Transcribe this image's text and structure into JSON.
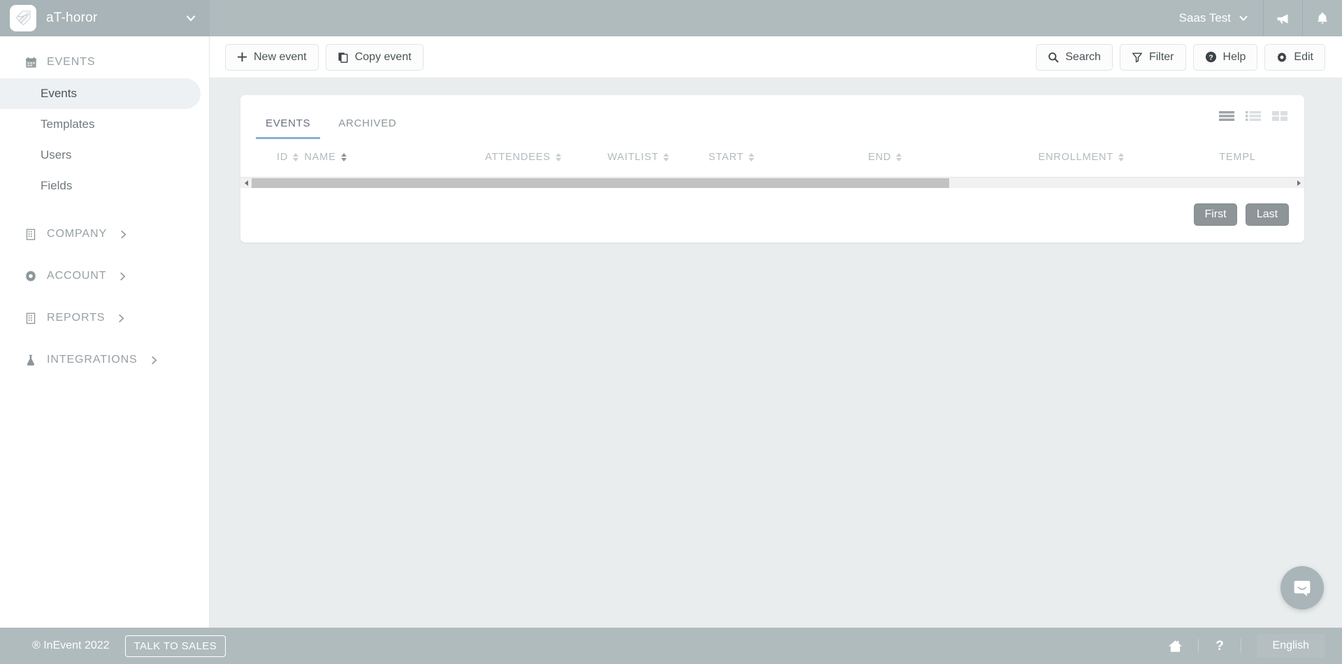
{
  "colors": {
    "topbar_bg": "#b0bbbe",
    "brand_bg": "#a8b4b7",
    "page_bg": "#e9edee",
    "card_bg": "#ffffff",
    "accent_tab_underline": "#8ab0d4",
    "pagination_btn": "#8d9598",
    "footer_bg": "#b0bbbe",
    "chat_bubble": "#a9b5b9"
  },
  "topbar": {
    "brand_name": "aT-horor",
    "brand_logo_icon": "inevent-logo-icon",
    "brand_caret_icon": "chevron-down-icon",
    "account_label": "Saas Test",
    "account_caret_icon": "chevron-down-icon",
    "announcements_icon": "megaphone-icon",
    "notifications_icon": "bell-icon"
  },
  "sidebar": {
    "groups": [
      {
        "label": "EVENTS",
        "icon": "calendar-icon",
        "expanded": true,
        "has_chevron": false,
        "items": [
          {
            "label": "Events",
            "active": true
          },
          {
            "label": "Templates",
            "active": false
          },
          {
            "label": "Users",
            "active": false
          },
          {
            "label": "Fields",
            "active": false
          }
        ]
      },
      {
        "label": "COMPANY",
        "icon": "building-icon",
        "expanded": false,
        "has_chevron": true,
        "chevron_icon": "chevron-right-icon",
        "items": []
      },
      {
        "label": "ACCOUNT",
        "icon": "gear-icon",
        "expanded": false,
        "has_chevron": true,
        "chevron_icon": "chevron-right-icon",
        "items": []
      },
      {
        "label": "REPORTS",
        "icon": "building-icon",
        "expanded": false,
        "has_chevron": true,
        "chevron_icon": "chevron-right-icon",
        "items": []
      },
      {
        "label": "INTEGRATIONS",
        "icon": "flask-icon",
        "expanded": false,
        "has_chevron": true,
        "chevron_icon": "chevron-right-icon",
        "items": []
      }
    ]
  },
  "actionbar": {
    "left_buttons": [
      {
        "label": "New event",
        "icon": "plus-icon"
      },
      {
        "label": "Copy event",
        "icon": "copy-icon"
      }
    ],
    "right_buttons": [
      {
        "label": "Search",
        "icon": "search-icon"
      },
      {
        "label": "Filter",
        "icon": "filter-icon"
      },
      {
        "label": "Help",
        "icon": "question-circle-icon"
      },
      {
        "label": "Edit",
        "icon": "gear-icon"
      }
    ]
  },
  "card": {
    "tabs": [
      {
        "label": "EVENTS",
        "active": true
      },
      {
        "label": "ARCHIVED",
        "active": false
      }
    ],
    "view_toggles": [
      {
        "name": "list-view-icon",
        "active": false
      },
      {
        "name": "compact-list-view-icon",
        "active": false
      },
      {
        "name": "grid-view-icon",
        "active": false
      }
    ],
    "table": {
      "columns": [
        {
          "label": "ID",
          "sort_active": false
        },
        {
          "label": "NAME",
          "sort_active": true
        },
        {
          "label": "ATTENDEES",
          "sort_active": false
        },
        {
          "label": "WAITLIST",
          "sort_active": false
        },
        {
          "label": "START",
          "sort_active": false
        },
        {
          "label": "END",
          "sort_active": false
        },
        {
          "label": "ENROLLMENT",
          "sort_active": false
        },
        {
          "label": "TEMPL",
          "sort_active": false
        }
      ],
      "rows": [],
      "scrollbar": {
        "left_arrow_icon": "chevron-left-icon",
        "right_arrow_icon": "chevron-right-icon",
        "thumb_width_percent": 67
      }
    },
    "pagination": {
      "first_label": "First",
      "last_label": "Last"
    }
  },
  "footer": {
    "copyright": "® InEvent 2022",
    "talk_to_sales": "TALK TO SALES",
    "home_icon": "home-icon",
    "help_icon": "question-mark-icon",
    "language": "English"
  },
  "chat": {
    "icon": "chat-bubble-icon"
  }
}
